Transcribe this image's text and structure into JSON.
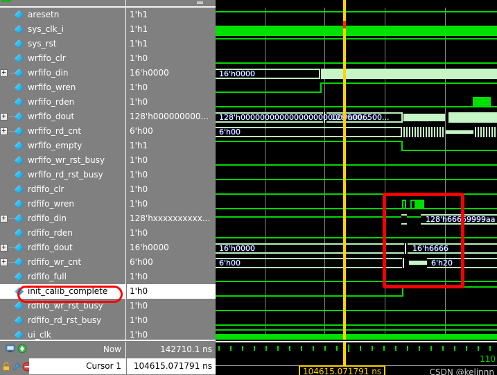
{
  "signals": [
    {
      "name": "aresetn",
      "value": "1'h1",
      "expandable": false
    },
    {
      "name": "sys_clk_i",
      "value": "1'h1",
      "expandable": false
    },
    {
      "name": "sys_rst",
      "value": "1'h1",
      "expandable": false
    },
    {
      "name": "wrfifo_clr",
      "value": "1'h0",
      "expandable": false
    },
    {
      "name": "wrfifo_din",
      "value": "16'h0000",
      "expandable": true
    },
    {
      "name": "wrfifo_wren",
      "value": "1'h0",
      "expandable": false
    },
    {
      "name": "wrfifo_rden",
      "value": "1'h0",
      "expandable": false
    },
    {
      "name": "wrfifo_dout",
      "value": "128'h000000000...",
      "expandable": true
    },
    {
      "name": "wrfifo_rd_cnt",
      "value": "6'h00",
      "expandable": true
    },
    {
      "name": "wrfifo_empty",
      "value": "1'h1",
      "expandable": false
    },
    {
      "name": "wrfifo_wr_rst_busy",
      "value": "1'h0",
      "expandable": false
    },
    {
      "name": "wrfifo_rd_rst_busy",
      "value": "1'h0",
      "expandable": false
    },
    {
      "name": "rdfifo_clr",
      "value": "1'h0",
      "expandable": false
    },
    {
      "name": "rdfifo_wren",
      "value": "1'h0",
      "expandable": false
    },
    {
      "name": "rdfifo_din",
      "value": "128'hxxxxxxxxxx...",
      "expandable": true
    },
    {
      "name": "rdfifo_rden",
      "value": "1'h0",
      "expandable": false
    },
    {
      "name": "rdfifo_dout",
      "value": "16'h0000",
      "expandable": true
    },
    {
      "name": "rdfifo_wr_cnt",
      "value": "6'h00",
      "expandable": true
    },
    {
      "name": "rdfifo_full",
      "value": "1'h0",
      "expandable": false
    },
    {
      "name": "init_calib_complete",
      "value": "1'h0",
      "expandable": false,
      "selected": true,
      "highlighted": true
    },
    {
      "name": "rdfifo_wr_rst_busy",
      "value": "1'h0",
      "expandable": false
    },
    {
      "name": "rdfifo_rd_rst_busy",
      "value": "1'h0",
      "expandable": false
    },
    {
      "name": "ui_clk",
      "value": "1'h0",
      "expandable": false,
      "clipped": true
    }
  ],
  "status": {
    "now_label": "Now",
    "now_value": "142710.1 ns",
    "cursor_label": "Cursor 1",
    "cursor_value": "104615.071791 ns"
  },
  "wave_labels": {
    "wrfifo_din_initial": "16'h0000",
    "wrfifo_dout_initial": "128'h0000000000000000000000000...",
    "wrfifo_dout_next": "128'h006500...",
    "wrfifo_rd_cnt_initial": "6'h00",
    "rdfifo_din_value": "128'h66669999aa",
    "rdfifo_dout_initial": "16'h0000",
    "rdfifo_dout_next": "16'h6666",
    "rdfifo_wr_cnt_initial": "6'h00",
    "rdfifo_wr_cnt_next": "6'h20"
  },
  "ruler": {
    "cursor_badge": "104615.071791 ns",
    "right_label": "110",
    "watermark": "CSDN @kelinnn"
  },
  "colors": {
    "panel_bg": "#808080",
    "wave_bg": "#000000",
    "signal_green": "#00d700",
    "bus_light": "#c6f5c6",
    "cursor_yellow": "#ffd200",
    "highlight_red": "#ff0000",
    "selection_white": "#ffffff"
  },
  "icons": {
    "signal": "diamond-icon",
    "expand": "plus-expander-icon",
    "status_left_1": "monitor-icon",
    "status_left_2": "green-add-icon",
    "status_left_3": "lock-icon",
    "status_left_4": "wrench-icon",
    "status_left_5": "remove-icon"
  }
}
